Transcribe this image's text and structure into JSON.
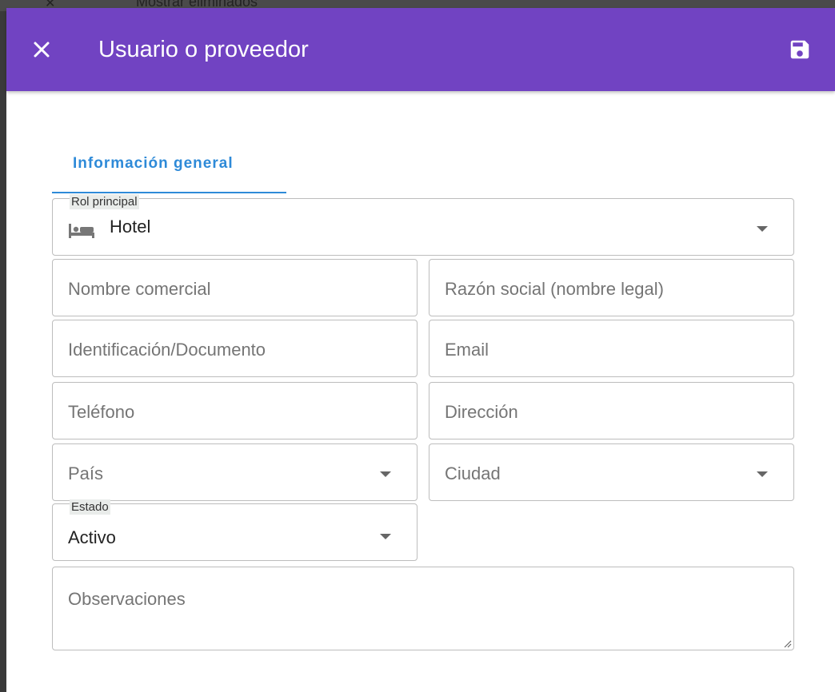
{
  "backdrop": {
    "text": "Mostrar eliminados"
  },
  "toolbar": {
    "title": "Usuario o proveedor",
    "close_icon": "close-icon",
    "save_icon": "floppy-disk-icon",
    "color": "#7143c2"
  },
  "tabs": [
    {
      "label": "Información general",
      "active": true,
      "color": "#2e8ad8"
    }
  ],
  "form": {
    "rol_principal": {
      "label": "Rol principal",
      "value": "Hotel",
      "icon": "bed-icon"
    },
    "nombre_comercial": {
      "placeholder": "Nombre comercial"
    },
    "razon_social": {
      "placeholder": "Razón social (nombre legal)"
    },
    "identificacion": {
      "placeholder": "Identificación/Documento"
    },
    "email": {
      "placeholder": "Email"
    },
    "telefono": {
      "placeholder": "Teléfono"
    },
    "direccion": {
      "placeholder": "Dirección"
    },
    "pais": {
      "placeholder": "País"
    },
    "ciudad": {
      "placeholder": "Ciudad"
    },
    "estado": {
      "label": "Estado",
      "value": "Activo"
    },
    "observaciones": {
      "placeholder": "Observaciones"
    }
  }
}
